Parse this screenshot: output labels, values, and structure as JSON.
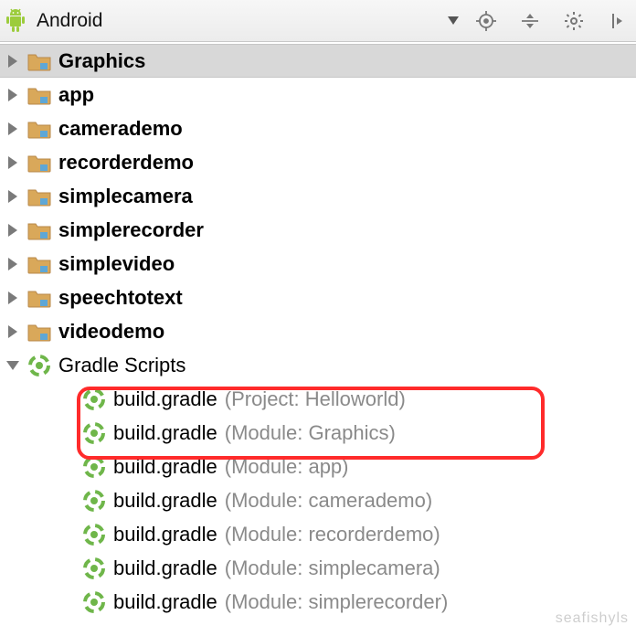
{
  "toolbar": {
    "title": "Android"
  },
  "tree": {
    "items": [
      {
        "label": "Graphics",
        "bold": true,
        "expanded": false,
        "selected": true,
        "icon": "folder"
      },
      {
        "label": "app",
        "bold": true,
        "expanded": false,
        "icon": "folder"
      },
      {
        "label": "camerademo",
        "bold": true,
        "expanded": false,
        "icon": "folder"
      },
      {
        "label": "recorderdemo",
        "bold": true,
        "expanded": false,
        "icon": "folder"
      },
      {
        "label": "simplecamera",
        "bold": true,
        "expanded": false,
        "icon": "folder"
      },
      {
        "label": "simplerecorder",
        "bold": true,
        "expanded": false,
        "icon": "folder"
      },
      {
        "label": "simplevideo",
        "bold": true,
        "expanded": false,
        "icon": "folder"
      },
      {
        "label": "speechtotext",
        "bold": true,
        "expanded": false,
        "icon": "folder"
      },
      {
        "label": "videodemo",
        "bold": true,
        "expanded": false,
        "icon": "folder"
      },
      {
        "label": "Gradle Scripts",
        "bold": false,
        "expanded": true,
        "icon": "gradle"
      }
    ],
    "children": [
      {
        "file": "build.gradle",
        "detail": "(Project: Helloworld)"
      },
      {
        "file": "build.gradle",
        "detail": "(Module: Graphics)"
      },
      {
        "file": "build.gradle",
        "detail": "(Module: app)"
      },
      {
        "file": "build.gradle",
        "detail": "(Module: camerademo)"
      },
      {
        "file": "build.gradle",
        "detail": "(Module: recorderdemo)"
      },
      {
        "file": "build.gradle",
        "detail": "(Module: simplecamera)"
      },
      {
        "file": "build.gradle",
        "detail": "(Module: simplerecorder)"
      }
    ]
  },
  "watermark": "seafishyls"
}
